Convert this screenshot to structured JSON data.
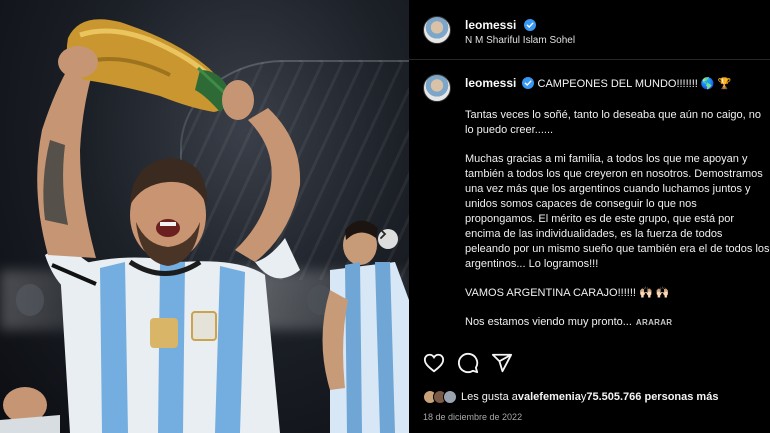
{
  "post": {
    "username": "leomessi",
    "header_subtitle": "N M Shariful Islam Sohel",
    "caption_title": "CAMPEONES DEL MUNDO!!!!!!! 🌎 🏆",
    "caption_paragraphs": [
      "Tantas veces lo soñé, tanto lo deseaba que aún no caigo, no lo puedo creer......",
      "Muchas gracias a mi familia, a todos los que me apoyan y también a todos los que creyeron en nosotros. Demostramos una vez más que los argentinos cuando luchamos juntos y unidos somos capaces de conseguir lo que nos propongamos. El mérito es de este grupo, que está por encima de las individualidades, es la fuerza de todos peleando por un mismo sueño que también era el de todos los argentinos... Lo logramos!!!",
      "VAMOS ARGENTINA CARAJO!!!!!! 🙌🏻 🙌🏻"
    ],
    "caption_last_line": "Nos estamos viendo muy pronto...",
    "translate_label": "ARARAR",
    "likes_text_prefix": "Les gusta a ",
    "likes_user": "valefemenia",
    "likes_text_mid": " y ",
    "likes_count": "75.505.766 personas más",
    "date": "18 de diciembre de 2022"
  },
  "icons": {
    "like": "heart-icon",
    "comment": "comment-icon",
    "share": "send-icon",
    "verified": "verified-badge-icon",
    "carousel": "chevron-right-icon"
  },
  "colors": {
    "background": "#000000",
    "verified": "#3897f0",
    "text": "#f5f5f5",
    "muted": "#a8a8a8"
  }
}
